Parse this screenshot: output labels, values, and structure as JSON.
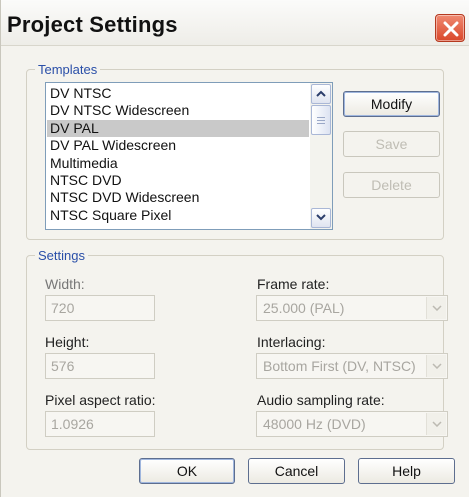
{
  "window": {
    "title": "Project Settings"
  },
  "templates": {
    "legend": "Templates",
    "items": [
      "DV NTSC",
      "DV NTSC Widescreen",
      "DV PAL",
      "DV PAL Widescreen",
      "Multimedia",
      "NTSC DVD",
      "NTSC DVD Widescreen",
      "NTSC Square Pixel"
    ],
    "selected": "DV PAL",
    "buttons": {
      "modify": "Modify",
      "save": "Save",
      "delete": "Delete"
    }
  },
  "settings": {
    "legend": "Settings",
    "width": {
      "label": "Width:",
      "value": "720"
    },
    "height": {
      "label": "Height:",
      "value": "576"
    },
    "pixel_aspect_ratio": {
      "label": "Pixel aspect ratio:",
      "value": "1.0926"
    },
    "frame_rate": {
      "label": "Frame rate:",
      "value": "25.000 (PAL)"
    },
    "interlacing": {
      "label": "Interlacing:",
      "value": "Bottom First (DV, NTSC)"
    },
    "audio_sampling_rate": {
      "label": "Audio sampling rate:",
      "value": "48000 Hz (DVD)"
    }
  },
  "footer": {
    "ok": "OK",
    "cancel": "Cancel",
    "help": "Help"
  },
  "colors": {
    "close_button": "#d9472a",
    "group_legend": "#2a4fa8",
    "selection": "#c9c9c9"
  },
  "icons": {
    "close": "close-icon",
    "scroll_up": "scroll-up-arrow-icon",
    "scroll_down": "scroll-down-arrow-icon",
    "dropdown": "chevron-down-icon"
  }
}
